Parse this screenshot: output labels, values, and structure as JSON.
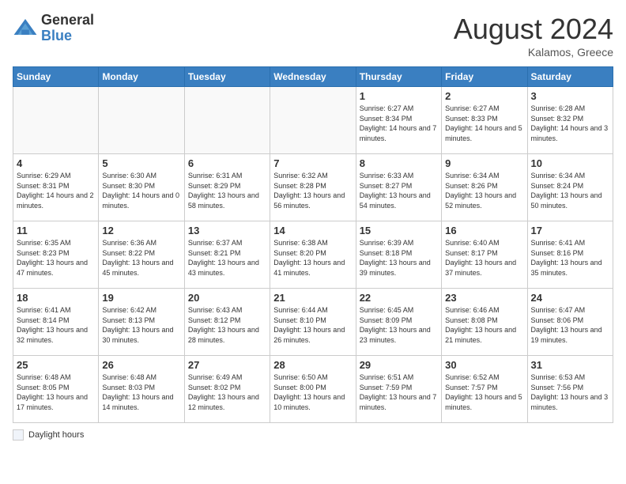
{
  "header": {
    "logo_general": "General",
    "logo_blue": "Blue",
    "month_year": "August 2024",
    "location": "Kalamos, Greece"
  },
  "weekdays": [
    "Sunday",
    "Monday",
    "Tuesday",
    "Wednesday",
    "Thursday",
    "Friday",
    "Saturday"
  ],
  "weeks": [
    [
      {
        "day": "",
        "empty": true
      },
      {
        "day": "",
        "empty": true
      },
      {
        "day": "",
        "empty": true
      },
      {
        "day": "",
        "empty": true
      },
      {
        "day": "1",
        "sunrise": "6:27 AM",
        "sunset": "8:34 PM",
        "daylight": "14 hours and 7 minutes."
      },
      {
        "day": "2",
        "sunrise": "6:27 AM",
        "sunset": "8:33 PM",
        "daylight": "14 hours and 5 minutes."
      },
      {
        "day": "3",
        "sunrise": "6:28 AM",
        "sunset": "8:32 PM",
        "daylight": "14 hours and 3 minutes."
      }
    ],
    [
      {
        "day": "4",
        "sunrise": "6:29 AM",
        "sunset": "8:31 PM",
        "daylight": "14 hours and 2 minutes."
      },
      {
        "day": "5",
        "sunrise": "6:30 AM",
        "sunset": "8:30 PM",
        "daylight": "14 hours and 0 minutes."
      },
      {
        "day": "6",
        "sunrise": "6:31 AM",
        "sunset": "8:29 PM",
        "daylight": "13 hours and 58 minutes."
      },
      {
        "day": "7",
        "sunrise": "6:32 AM",
        "sunset": "8:28 PM",
        "daylight": "13 hours and 56 minutes."
      },
      {
        "day": "8",
        "sunrise": "6:33 AM",
        "sunset": "8:27 PM",
        "daylight": "13 hours and 54 minutes."
      },
      {
        "day": "9",
        "sunrise": "6:34 AM",
        "sunset": "8:26 PM",
        "daylight": "13 hours and 52 minutes."
      },
      {
        "day": "10",
        "sunrise": "6:34 AM",
        "sunset": "8:24 PM",
        "daylight": "13 hours and 50 minutes."
      }
    ],
    [
      {
        "day": "11",
        "sunrise": "6:35 AM",
        "sunset": "8:23 PM",
        "daylight": "13 hours and 47 minutes."
      },
      {
        "day": "12",
        "sunrise": "6:36 AM",
        "sunset": "8:22 PM",
        "daylight": "13 hours and 45 minutes."
      },
      {
        "day": "13",
        "sunrise": "6:37 AM",
        "sunset": "8:21 PM",
        "daylight": "13 hours and 43 minutes."
      },
      {
        "day": "14",
        "sunrise": "6:38 AM",
        "sunset": "8:20 PM",
        "daylight": "13 hours and 41 minutes."
      },
      {
        "day": "15",
        "sunrise": "6:39 AM",
        "sunset": "8:18 PM",
        "daylight": "13 hours and 39 minutes."
      },
      {
        "day": "16",
        "sunrise": "6:40 AM",
        "sunset": "8:17 PM",
        "daylight": "13 hours and 37 minutes."
      },
      {
        "day": "17",
        "sunrise": "6:41 AM",
        "sunset": "8:16 PM",
        "daylight": "13 hours and 35 minutes."
      }
    ],
    [
      {
        "day": "18",
        "sunrise": "6:41 AM",
        "sunset": "8:14 PM",
        "daylight": "13 hours and 32 minutes."
      },
      {
        "day": "19",
        "sunrise": "6:42 AM",
        "sunset": "8:13 PM",
        "daylight": "13 hours and 30 minutes."
      },
      {
        "day": "20",
        "sunrise": "6:43 AM",
        "sunset": "8:12 PM",
        "daylight": "13 hours and 28 minutes."
      },
      {
        "day": "21",
        "sunrise": "6:44 AM",
        "sunset": "8:10 PM",
        "daylight": "13 hours and 26 minutes."
      },
      {
        "day": "22",
        "sunrise": "6:45 AM",
        "sunset": "8:09 PM",
        "daylight": "13 hours and 23 minutes."
      },
      {
        "day": "23",
        "sunrise": "6:46 AM",
        "sunset": "8:08 PM",
        "daylight": "13 hours and 21 minutes."
      },
      {
        "day": "24",
        "sunrise": "6:47 AM",
        "sunset": "8:06 PM",
        "daylight": "13 hours and 19 minutes."
      }
    ],
    [
      {
        "day": "25",
        "sunrise": "6:48 AM",
        "sunset": "8:05 PM",
        "daylight": "13 hours and 17 minutes."
      },
      {
        "day": "26",
        "sunrise": "6:48 AM",
        "sunset": "8:03 PM",
        "daylight": "13 hours and 14 minutes."
      },
      {
        "day": "27",
        "sunrise": "6:49 AM",
        "sunset": "8:02 PM",
        "daylight": "13 hours and 12 minutes."
      },
      {
        "day": "28",
        "sunrise": "6:50 AM",
        "sunset": "8:00 PM",
        "daylight": "13 hours and 10 minutes."
      },
      {
        "day": "29",
        "sunrise": "6:51 AM",
        "sunset": "7:59 PM",
        "daylight": "13 hours and 7 minutes."
      },
      {
        "day": "30",
        "sunrise": "6:52 AM",
        "sunset": "7:57 PM",
        "daylight": "13 hours and 5 minutes."
      },
      {
        "day": "31",
        "sunrise": "6:53 AM",
        "sunset": "7:56 PM",
        "daylight": "13 hours and 3 minutes."
      }
    ]
  ],
  "legend": {
    "label": "Daylight hours"
  }
}
